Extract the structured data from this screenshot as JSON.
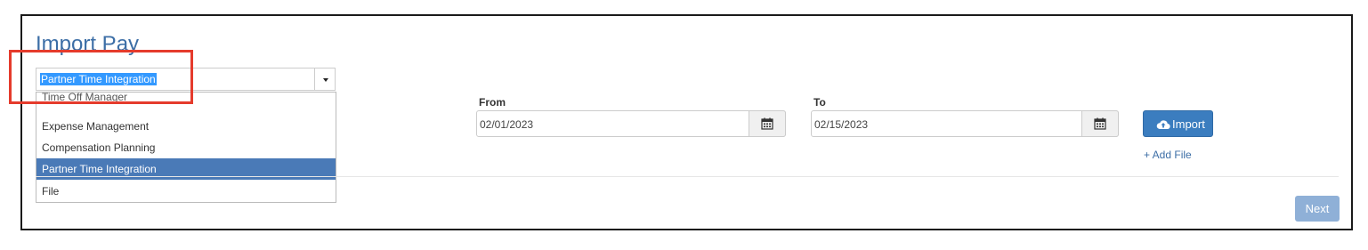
{
  "page": {
    "title": "Import Pay"
  },
  "import_type_select": {
    "selected": "Partner Time Integration",
    "options": [
      {
        "label": "Time Off Manager"
      },
      {
        "label": "Expense Management"
      },
      {
        "label": "Compensation Planning"
      },
      {
        "label": "Partner Time Integration"
      },
      {
        "label": "File"
      }
    ],
    "selected_index": 3
  },
  "date_range": {
    "from_label": "From",
    "from_value": "02/01/2023",
    "to_label": "To",
    "to_value": "02/15/2023"
  },
  "actions": {
    "import_label": "Import",
    "add_file_label": "+ Add File",
    "next_label": "Next"
  },
  "icons": {
    "calendar": "calendar-icon",
    "upload": "cloud-upload-icon",
    "dropdown": "caret-down-icon"
  },
  "colors": {
    "accent": "#3b7dbf",
    "selected_option": "#4a7ab7",
    "highlight_box": "#e53b2c",
    "title": "#3c6ea6",
    "next_disabled": "#8fb0d7"
  }
}
